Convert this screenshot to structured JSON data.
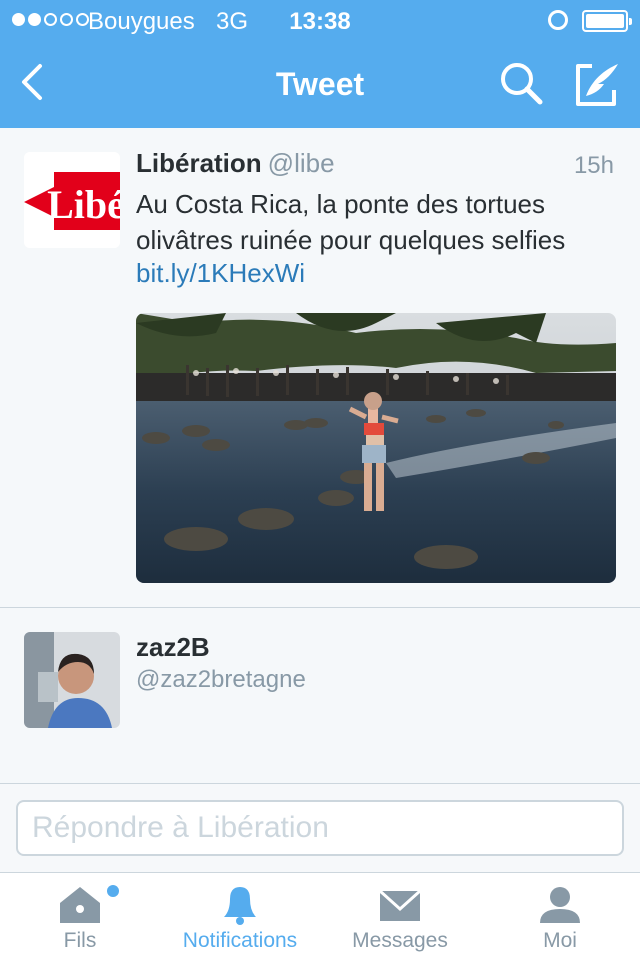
{
  "status_bar": {
    "signal_bars_filled": 2,
    "signal_bars_total": 5,
    "carrier": "Bouygues",
    "network": "3G",
    "time": "13:38"
  },
  "nav": {
    "title": "Tweet",
    "icons": [
      "back-chevron-icon",
      "search-icon",
      "compose-tweet-icon"
    ]
  },
  "tweet": {
    "author_name": "Libération",
    "author_handle": "@libe",
    "avatar_logo_text": "Libé",
    "time_ago": "15h",
    "text": "Au Costa Rica, la ponte des tortues olivâtres ruinée pour quelques selfies",
    "link": "bit.ly/1KHexWi"
  },
  "reply_user": {
    "name": "zaz2B",
    "handle": "@zaz2bretagne"
  },
  "reply_input": {
    "placeholder": "Répondre à Libération",
    "value": ""
  },
  "tabs": [
    {
      "label": "Fils",
      "icon": "home-icon",
      "active": false,
      "unread": true
    },
    {
      "label": "Notifications",
      "icon": "bell-icon",
      "active": true,
      "unread": false
    },
    {
      "label": "Messages",
      "icon": "envelope-icon",
      "active": false,
      "unread": false
    },
    {
      "label": "Moi",
      "icon": "person-icon",
      "active": false,
      "unread": false
    }
  ],
  "colors": {
    "header": "#55acee",
    "link": "#2b7bb9",
    "text": "#292f33",
    "muted": "#8899a6",
    "background": "#f5f8fa"
  }
}
